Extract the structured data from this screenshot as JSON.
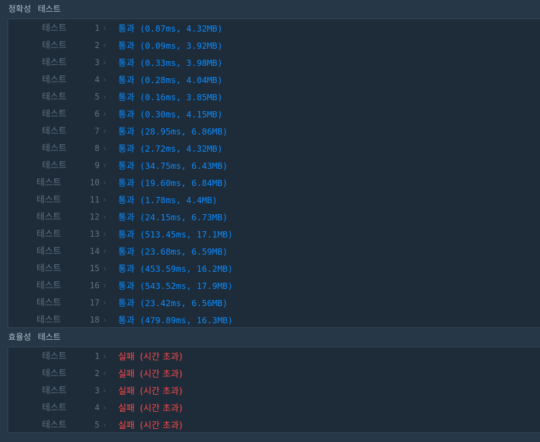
{
  "accuracy": {
    "title": "정확성",
    "subtitle": "테스트",
    "tests": [
      {
        "label": "테스트",
        "num": "1",
        "status": "통과",
        "detail": "(0.87ms, 4.32MB)"
      },
      {
        "label": "테스트",
        "num": "2",
        "status": "통과",
        "detail": "(0.09ms, 3.92MB)"
      },
      {
        "label": "테스트",
        "num": "3",
        "status": "통과",
        "detail": "(0.33ms, 3.98MB)"
      },
      {
        "label": "테스트",
        "num": "4",
        "status": "통과",
        "detail": "(0.28ms, 4.04MB)"
      },
      {
        "label": "테스트",
        "num": "5",
        "status": "통과",
        "detail": "(0.16ms, 3.85MB)"
      },
      {
        "label": "테스트",
        "num": "6",
        "status": "통과",
        "detail": "(0.30ms, 4.15MB)"
      },
      {
        "label": "테스트",
        "num": "7",
        "status": "통과",
        "detail": "(28.95ms, 6.86MB)"
      },
      {
        "label": "테스트",
        "num": "8",
        "status": "통과",
        "detail": "(2.72ms, 4.32MB)"
      },
      {
        "label": "테스트",
        "num": "9",
        "status": "통과",
        "detail": "(34.75ms, 6.43MB)"
      },
      {
        "label": "테스트",
        "num": "10",
        "status": "통과",
        "detail": "(19.60ms, 6.84MB)"
      },
      {
        "label": "테스트",
        "num": "11",
        "status": "통과",
        "detail": "(1.78ms, 4.4MB)"
      },
      {
        "label": "테스트",
        "num": "12",
        "status": "통과",
        "detail": "(24.15ms, 6.73MB)"
      },
      {
        "label": "테스트",
        "num": "13",
        "status": "통과",
        "detail": "(513.45ms, 17.1MB)"
      },
      {
        "label": "테스트",
        "num": "14",
        "status": "통과",
        "detail": "(23.68ms, 6.59MB)"
      },
      {
        "label": "테스트",
        "num": "15",
        "status": "통과",
        "detail": "(453.59ms, 16.2MB)"
      },
      {
        "label": "테스트",
        "num": "16",
        "status": "통과",
        "detail": "(543.52ms, 17.9MB)"
      },
      {
        "label": "테스트",
        "num": "17",
        "status": "통과",
        "detail": "(23.42ms, 6.56MB)"
      },
      {
        "label": "테스트",
        "num": "18",
        "status": "통과",
        "detail": "(479.89ms, 16.3MB)"
      }
    ]
  },
  "efficiency": {
    "title": "효율성",
    "subtitle": "테스트",
    "tests": [
      {
        "label": "테스트",
        "num": "1",
        "status": "실패",
        "detail": "(시간 초과)"
      },
      {
        "label": "테스트",
        "num": "2",
        "status": "실패",
        "detail": "(시간 초과)"
      },
      {
        "label": "테스트",
        "num": "3",
        "status": "실패",
        "detail": "(시간 초과)"
      },
      {
        "label": "테스트",
        "num": "4",
        "status": "실패",
        "detail": "(시간 초과)"
      },
      {
        "label": "테스트",
        "num": "5",
        "status": "실패",
        "detail": "(시간 초과)"
      }
    ]
  },
  "colors": {
    "pass": "#0b8cff",
    "fail": "#ff4b4b",
    "label": "#5e7385",
    "background": "#263747",
    "panel": "#1e2b38"
  },
  "icons": {
    "row_chevron": "chevron-right-icon"
  }
}
